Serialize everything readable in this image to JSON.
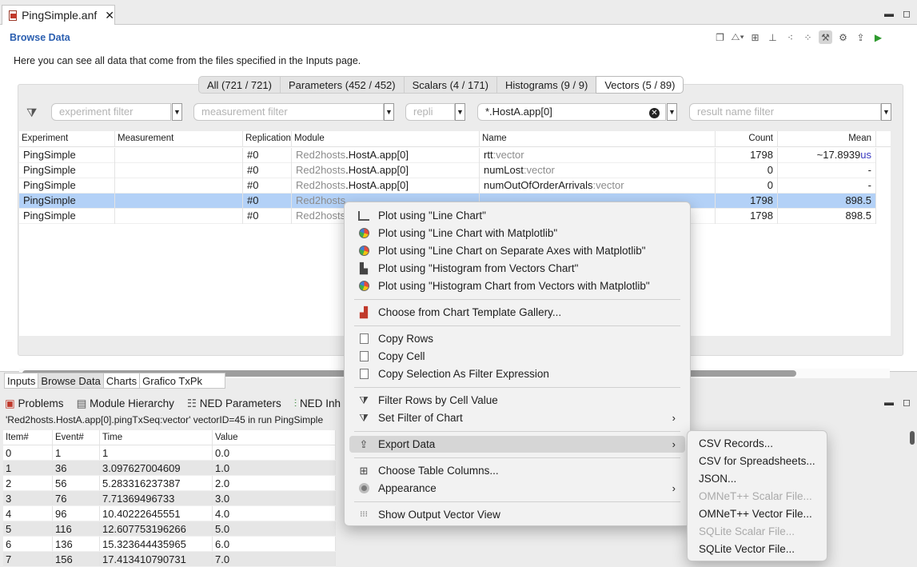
{
  "editor": {
    "tab_title": "PingSimple.anf",
    "section_title": "Browse Data",
    "description": "Here you can see all data that come from the files specified in the Inputs page."
  },
  "result_tabs": [
    {
      "label": "All (721 / 721)"
    },
    {
      "label": "Parameters (452 / 452)"
    },
    {
      "label": "Scalars (4 / 171)"
    },
    {
      "label": "Histograms (9 / 9)"
    },
    {
      "label": "Vectors (5 / 89)"
    }
  ],
  "filters": {
    "experiment_placeholder": "experiment filter",
    "measurement_placeholder": "measurement filter",
    "replication_placeholder": "repli",
    "module_value": "*.HostA.app[0]",
    "name_placeholder": "result name filter"
  },
  "grid": {
    "columns": [
      "Experiment",
      "Measurement",
      "Replication",
      "Module",
      "Name",
      "Count",
      "Mean"
    ],
    "rows": [
      {
        "experiment": "PingSimple",
        "measurement": "",
        "replication": "#0",
        "module_prefix": "Red2hosts",
        "module_suffix": ".HostA.app[0]",
        "name": "rtt",
        "name_suffix": ":vector",
        "count": "1798",
        "mean": "~17.8939",
        "mean_unit": "us"
      },
      {
        "experiment": "PingSimple",
        "measurement": "",
        "replication": "#0",
        "module_prefix": "Red2hosts",
        "module_suffix": ".HostA.app[0]",
        "name": "numLost",
        "name_suffix": ":vector",
        "count": "0",
        "mean": "-",
        "mean_unit": ""
      },
      {
        "experiment": "PingSimple",
        "measurement": "",
        "replication": "#0",
        "module_prefix": "Red2hosts",
        "module_suffix": ".HostA.app[0]",
        "name": "numOutOfOrderArrivals",
        "name_suffix": ":vector",
        "count": "0",
        "mean": "-",
        "mean_unit": ""
      },
      {
        "experiment": "PingSimple",
        "measurement": "",
        "replication": "#0",
        "module_prefix": "Red2hosts",
        "module_suffix": "",
        "name": "",
        "name_suffix": "",
        "count": "1798",
        "mean": "898.5",
        "mean_unit": ""
      },
      {
        "experiment": "PingSimple",
        "measurement": "",
        "replication": "#0",
        "module_prefix": "Red2hosts",
        "module_suffix": "",
        "name": "",
        "name_suffix": "",
        "count": "1798",
        "mean": "898.5",
        "mean_unit": ""
      }
    ]
  },
  "page_tabs": [
    {
      "label": "Inputs"
    },
    {
      "label": "Browse Data"
    },
    {
      "label": "Charts"
    },
    {
      "label": "Grafico TxPk"
    }
  ],
  "views": [
    {
      "label": "Problems"
    },
    {
      "label": "Module Hierarchy"
    },
    {
      "label": "NED Parameters"
    },
    {
      "label": "NED Inh"
    }
  ],
  "vector": {
    "caption": "'Red2hosts.HostA.app[0].pingTxSeq:vector' vectorID=45 in run PingSimple",
    "columns": [
      "Item#",
      "Event#",
      "Time",
      "Value"
    ],
    "rows": [
      [
        "0",
        "1",
        "1",
        "0.0"
      ],
      [
        "1",
        "36",
        "3.097627004609",
        "1.0"
      ],
      [
        "2",
        "56",
        "5.283316237387",
        "2.0"
      ],
      [
        "3",
        "76",
        "7.71369496733",
        "3.0"
      ],
      [
        "4",
        "96",
        "10.40222645551",
        "4.0"
      ],
      [
        "5",
        "116",
        "12.607753196266",
        "5.0"
      ],
      [
        "6",
        "136",
        "15.323644435965",
        "6.0"
      ],
      [
        "7",
        "156",
        "17.413410790731",
        "7.0"
      ]
    ]
  },
  "context_menu": {
    "items": [
      {
        "label": "Plot using \"Line Chart\""
      },
      {
        "label": "Plot using \"Line Chart with Matplotlib\""
      },
      {
        "label": "Plot using \"Line Chart on Separate Axes with Matplotlib\""
      },
      {
        "label": "Plot using \"Histogram from Vectors Chart\""
      },
      {
        "label": "Plot using \"Histogram Chart from Vectors with Matplotlib\""
      },
      {
        "label": "Choose from Chart Template Gallery..."
      },
      {
        "label": "Copy Rows"
      },
      {
        "label": "Copy Cell"
      },
      {
        "label": "Copy Selection As Filter Expression"
      },
      {
        "label": "Filter Rows by Cell Value"
      },
      {
        "label": "Set Filter of Chart"
      },
      {
        "label": "Export Data"
      },
      {
        "label": "Choose Table Columns..."
      },
      {
        "label": "Appearance"
      },
      {
        "label": "Show Output Vector View"
      }
    ]
  },
  "export_submenu": {
    "items": [
      {
        "label": "CSV Records..."
      },
      {
        "label": "CSV for Spreadsheets..."
      },
      {
        "label": "JSON..."
      },
      {
        "label": "OMNeT++ Scalar File..."
      },
      {
        "label": "OMNeT++ Vector File..."
      },
      {
        "label": "SQLite Scalar File..."
      },
      {
        "label": "SQLite Vector File..."
      }
    ]
  }
}
